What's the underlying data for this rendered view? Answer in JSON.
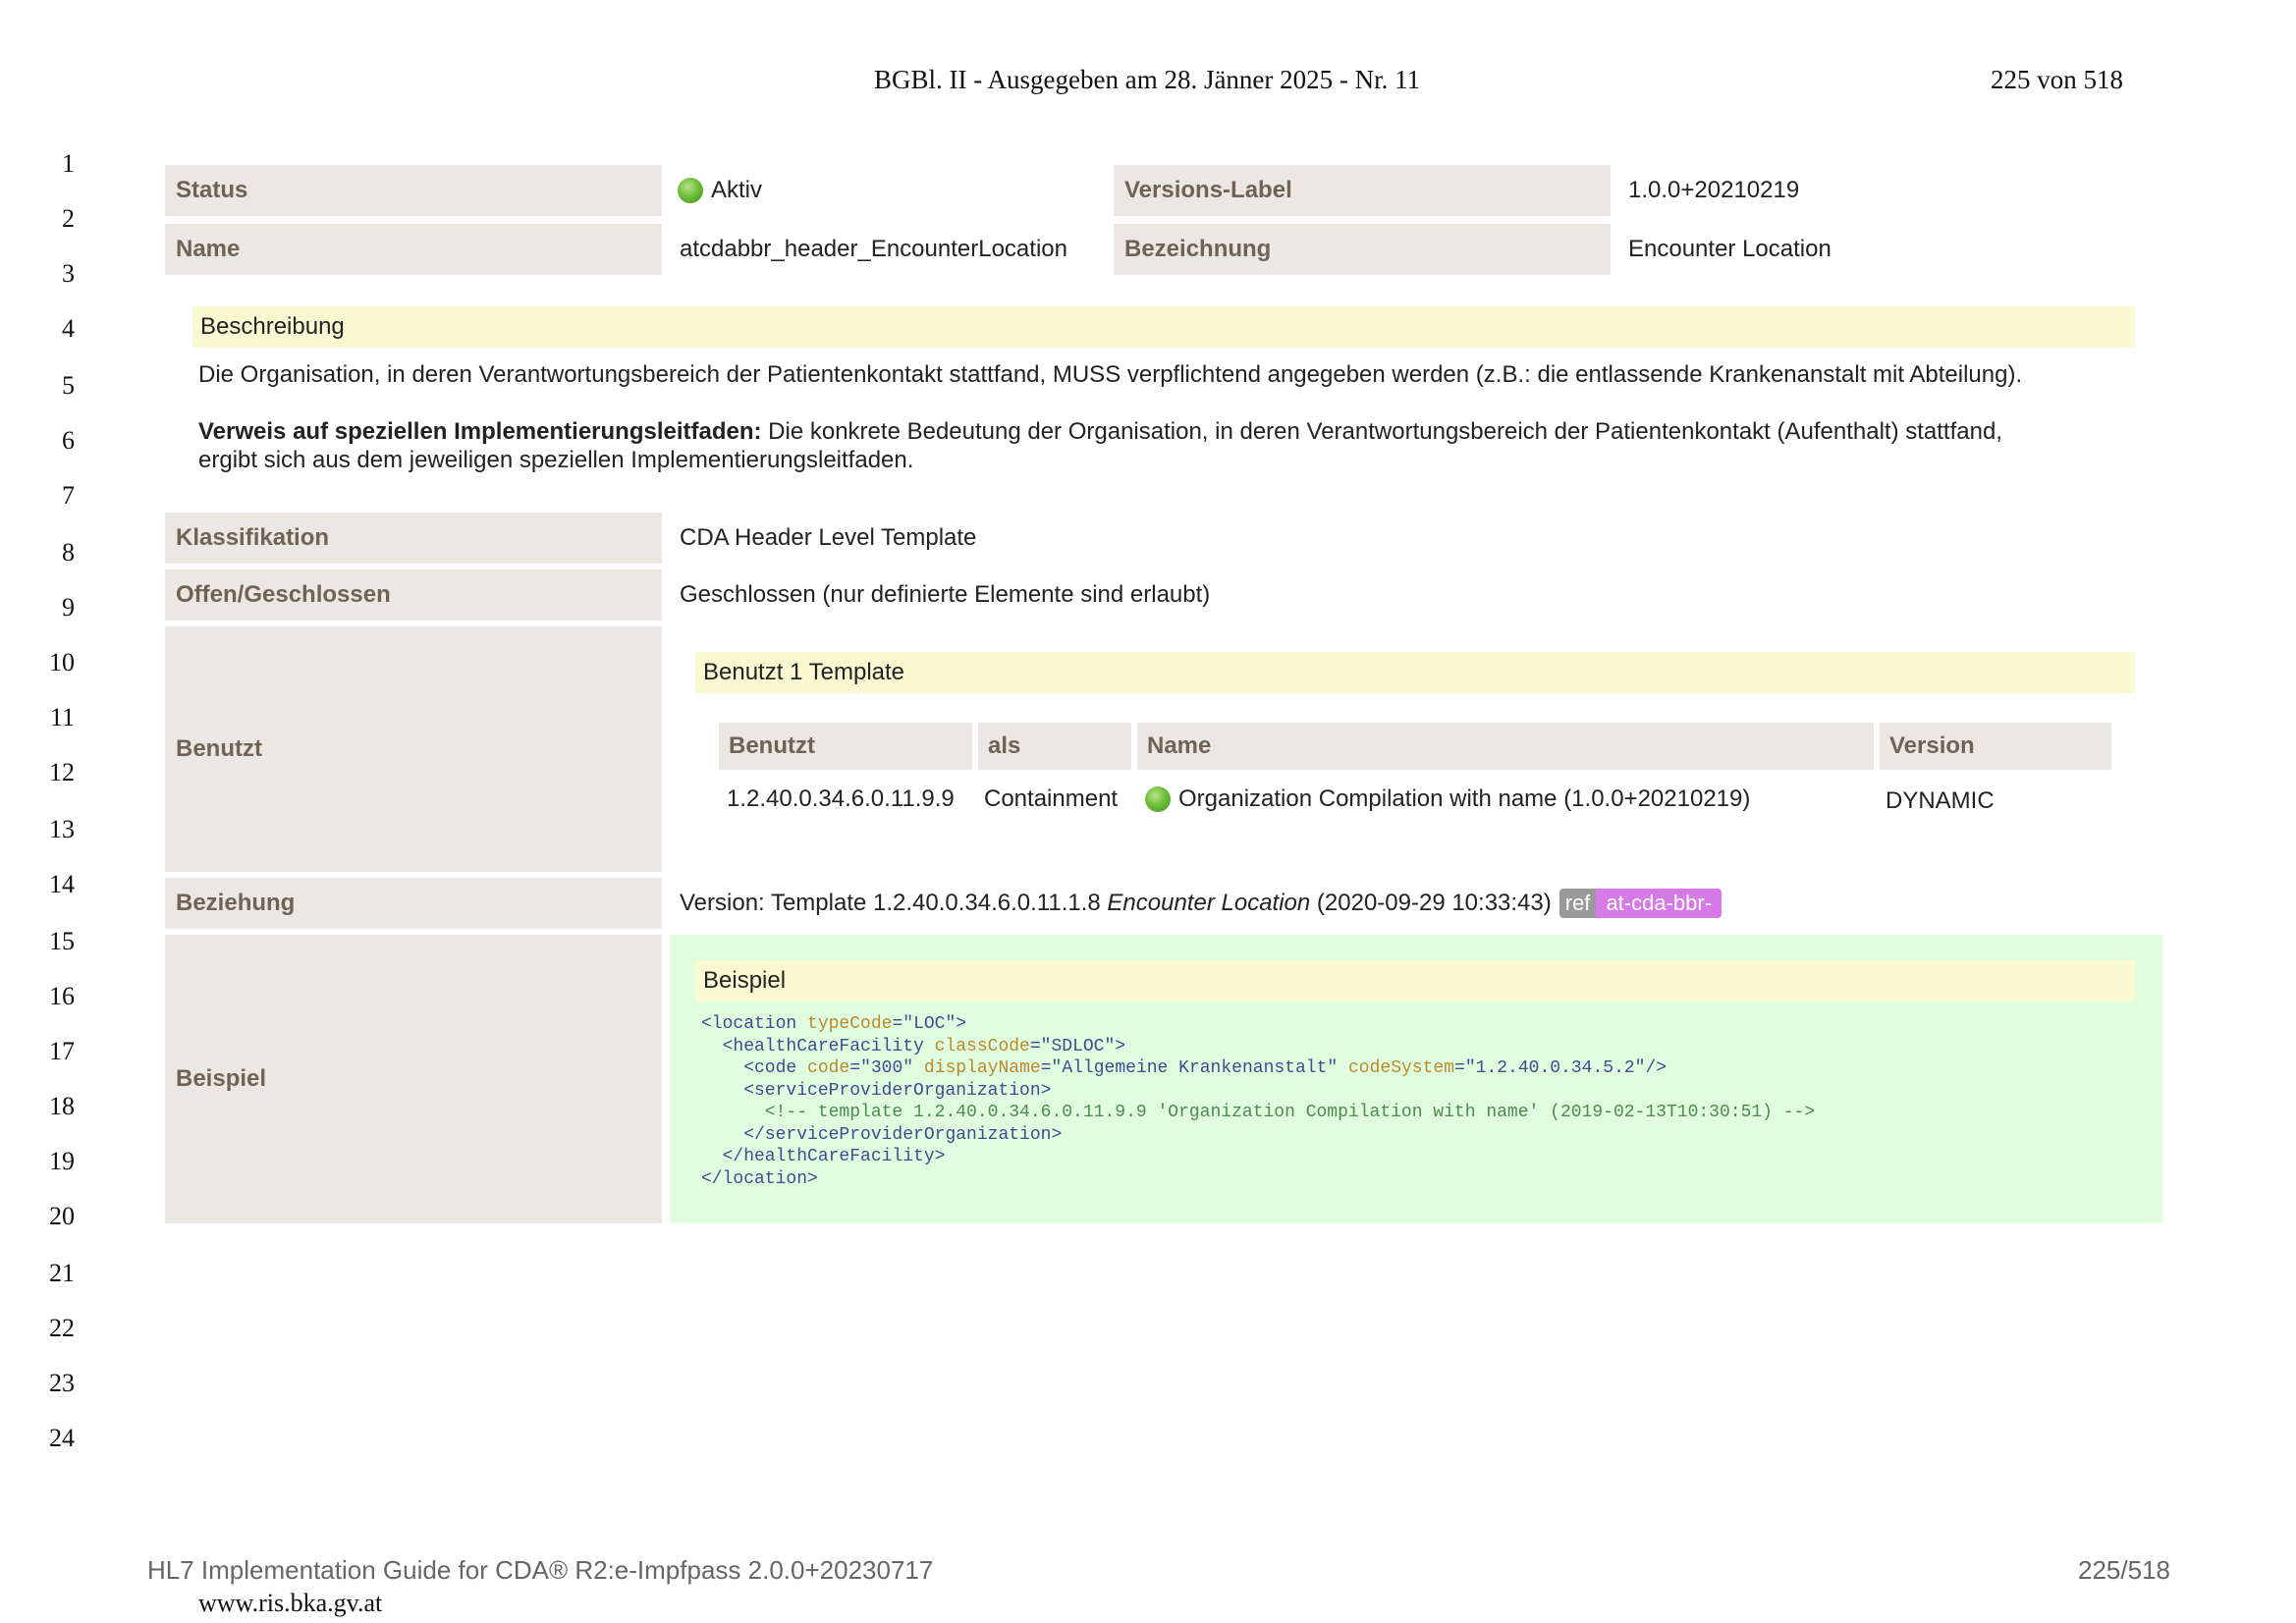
{
  "page_header": {
    "title": "BGBl. II - Ausgegeben am 28. Jänner 2025 - Nr. 11",
    "page": "225 von 518"
  },
  "line_numbers": [
    "1",
    "2",
    "3",
    "4",
    "5",
    "6",
    "7",
    "8",
    "9",
    "10",
    "11",
    "12",
    "13",
    "14",
    "15",
    "16",
    "17",
    "18",
    "19",
    "20",
    "21",
    "22",
    "23",
    "24"
  ],
  "meta": {
    "status_label": "Status",
    "status_value": "Aktiv",
    "version_label": "Versions-Label",
    "version_value": "1.0.0+20210219",
    "name_label": "Name",
    "name_value": "atcdabbr_header_EncounterLocation",
    "bezeichnung_label": "Bezeichnung",
    "bezeichnung_value": "Encounter Location"
  },
  "beschreibung": {
    "title": "Beschreibung",
    "text": "Die Organisation, in deren Verantwortungsbereich der Patientenkontakt stattfand, MUSS verpflichtend angegeben werden (z.B.: die entlassende Krankenanstalt mit Abteilung).",
    "verweis_bold": "Verweis auf speziellen Implementierungsleitfaden:",
    "verweis_text1": " Die konkrete Bedeutung der Organisation, in deren Verantwortungsbereich der Patientenkontakt (Aufenthalt) stattfand,",
    "verweis_text2": "ergibt sich aus dem jeweiligen speziellen Implementierungsleitfaden."
  },
  "klassifikation": {
    "label": "Klassifikation",
    "value": "CDA Header Level Template"
  },
  "offen": {
    "label": "Offen/Geschlossen",
    "value": "Geschlossen (nur definierte Elemente sind erlaubt)"
  },
  "benutzt": {
    "label": "Benutzt",
    "title": "Benutzt 1 Template",
    "headers": [
      "Benutzt",
      "als",
      "Name",
      "Version"
    ],
    "row": {
      "id": "1.2.40.0.34.6.0.11.9.9",
      "als": "Containment",
      "name": "Organization Compilation with name (1.0.0+20210219)",
      "version": "DYNAMIC"
    }
  },
  "beziehung": {
    "label": "Beziehung",
    "prefix": "Version: Template 1.2.40.0.34.6.0.11.1.8 ",
    "italic": "Encounter Location",
    "suffix": " (2020‑09‑29 10:33:43)",
    "ref_a": "ref",
    "ref_b": "at-cda-bbr-"
  },
  "beispiel": {
    "label": "Beispiel",
    "title": "Beispiel",
    "code": {
      "l1_tag": "<location ",
      "l1_attr": "typeCode",
      "l1_val": "\"LOC\"",
      "l1_end": ">",
      "l2_tag": "  <healthCareFacility ",
      "l2_attr": "classCode",
      "l2_val": "\"SDLOC\"",
      "l2_end": ">",
      "l3_tag": "    <code ",
      "l3_a1": "code",
      "l3_v1": "\"300\"",
      "l3_a2": "displayName",
      "l3_v2": "\"Allgemeine Krankenanstalt\"",
      "l3_a3": "codeSystem",
      "l3_v3": "\"1.2.40.0.34.5.2\"",
      "l3_end": "/>",
      "l4": "    <serviceProviderOrganization>",
      "l5": "      <!-- template 1.2.40.0.34.6.0.11.9.9 'Organization Compilation with name' (2019-02-13T10:30:51) -->",
      "l6": "    </serviceProviderOrganization>",
      "l7": "  </healthCareFacility>",
      "l8": "</location>"
    }
  },
  "footer": {
    "left": "HL7 Implementation Guide for CDA® R2:e-Impfpass 2.0.0+20230717",
    "right": "225/518",
    "url": "www.ris.bka.gv.at"
  }
}
